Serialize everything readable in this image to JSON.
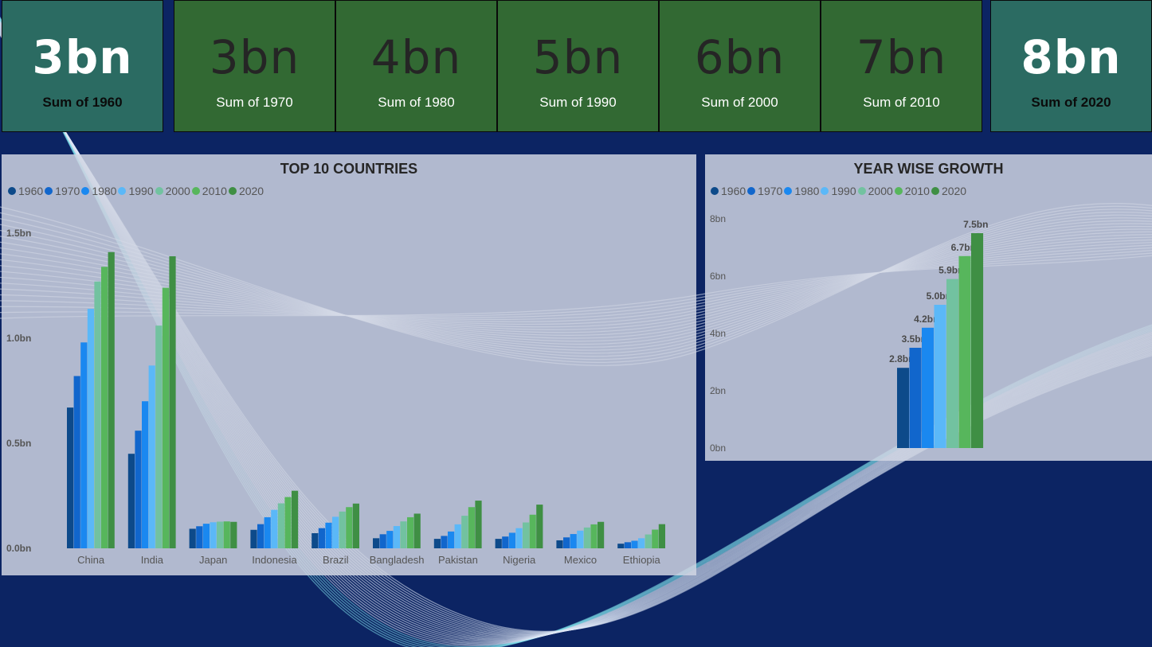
{
  "cards": [
    {
      "value": "3bn",
      "label": "Sum of 1960",
      "style": "teal"
    },
    {
      "value": "3bn",
      "label": "Sum of 1970",
      "style": "green"
    },
    {
      "value": "4bn",
      "label": "Sum of 1980",
      "style": "green"
    },
    {
      "value": "5bn",
      "label": "Sum of 1990",
      "style": "green"
    },
    {
      "value": "6bn",
      "label": "Sum of 2000",
      "style": "green"
    },
    {
      "value": "7bn",
      "label": "Sum of 2010",
      "style": "green"
    },
    {
      "value": "8bn",
      "label": "Sum of 2020",
      "style": "teal"
    }
  ],
  "colors": {
    "background": "#0c2463",
    "series": [
      "#0d4a8a",
      "#1166cc",
      "#1a88f0",
      "#5bb8f8",
      "#72c2a0",
      "#57b65c",
      "#3f8f44"
    ]
  },
  "chart_data": [
    {
      "type": "bar",
      "title": "TOP 10 COUNTRIES",
      "legend_position": "top-left",
      "categories": [
        "China",
        "India",
        "Japan",
        "Indonesia",
        "Brazil",
        "Bangladesh",
        "Pakistan",
        "Nigeria",
        "Mexico",
        "Ethiopia"
      ],
      "y_ticks": [
        "0.0bn",
        "0.5bn",
        "1.0bn",
        "1.5bn"
      ],
      "ylim": [
        0,
        1.5
      ],
      "series": [
        {
          "name": "1960",
          "values": [
            0.67,
            0.45,
            0.093,
            0.088,
            0.072,
            0.048,
            0.045,
            0.045,
            0.038,
            0.022
          ]
        },
        {
          "name": "1970",
          "values": [
            0.82,
            0.56,
            0.105,
            0.115,
            0.096,
            0.067,
            0.059,
            0.056,
            0.052,
            0.029
          ]
        },
        {
          "name": "1980",
          "values": [
            0.98,
            0.7,
            0.117,
            0.148,
            0.122,
            0.083,
            0.08,
            0.074,
            0.068,
            0.036
          ]
        },
        {
          "name": "1990",
          "values": [
            1.14,
            0.87,
            0.124,
            0.183,
            0.15,
            0.106,
            0.114,
            0.096,
            0.084,
            0.048
          ]
        },
        {
          "name": "2000",
          "values": [
            1.27,
            1.06,
            0.127,
            0.214,
            0.175,
            0.128,
            0.155,
            0.123,
            0.099,
            0.066
          ]
        },
        {
          "name": "2010",
          "values": [
            1.34,
            1.24,
            0.128,
            0.244,
            0.196,
            0.148,
            0.196,
            0.16,
            0.114,
            0.089
          ]
        },
        {
          "name": "2020",
          "values": [
            1.41,
            1.39,
            0.126,
            0.274,
            0.213,
            0.165,
            0.227,
            0.208,
            0.126,
            0.115
          ]
        }
      ]
    },
    {
      "type": "bar",
      "title": "YEAR WISE GROWTH",
      "legend_position": "top-left",
      "y_ticks": [
        "0bn",
        "2bn",
        "4bn",
        "6bn",
        "8bn"
      ],
      "ylim": [
        0,
        8
      ],
      "series": [
        {
          "name": "1960",
          "value": 2.8,
          "label": "2.8bn"
        },
        {
          "name": "1970",
          "value": 3.5,
          "label": "3.5bn"
        },
        {
          "name": "1980",
          "value": 4.2,
          "label": "4.2bn"
        },
        {
          "name": "1990",
          "value": 5.0,
          "label": "5.0bn"
        },
        {
          "name": "2000",
          "value": 5.9,
          "label": "5.9bn"
        },
        {
          "name": "2010",
          "value": 6.7,
          "label": "6.7bn"
        },
        {
          "name": "2020",
          "value": 7.5,
          "label": "7.5bn"
        }
      ]
    }
  ]
}
